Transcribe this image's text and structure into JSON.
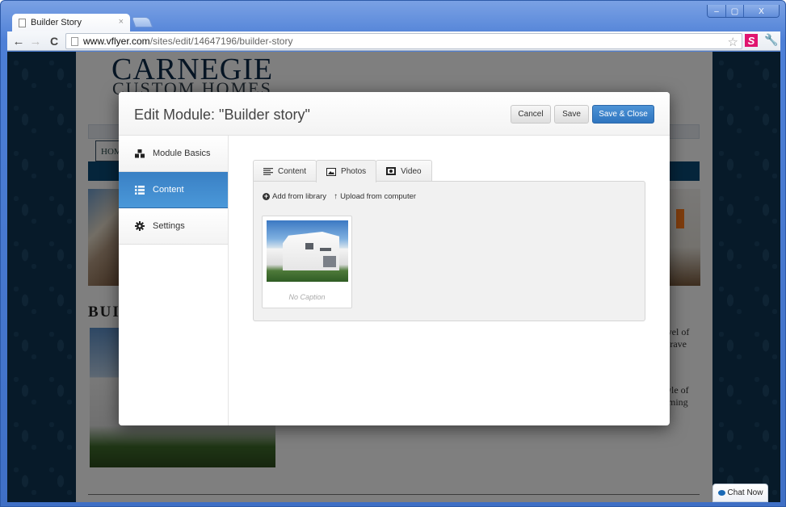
{
  "browser": {
    "tab_title": "Builder Story",
    "tab_close": "×",
    "url_host": "www.vflyer.com",
    "url_path": "/sites/edit/14647196/builder-story",
    "window_controls": [
      "–",
      "▢",
      "X"
    ],
    "nav": {
      "back": "←",
      "forward": "→",
      "reload": "C"
    },
    "bookmark_star": "☆",
    "extension_label": "S",
    "wrench": "🔧"
  },
  "site": {
    "logo_line1": "CARNEGIE",
    "logo_line2": "CUSTOM HOMES",
    "home_tab": "HOME",
    "section_title": "BUILDER STORY",
    "side_text_1": [
      "level of",
      "r crave"
    ],
    "side_text_2": [
      "style of",
      "orming"
    ],
    "chat_label": "Chat Now"
  },
  "modal": {
    "title": "Edit Module: \"Builder story\"",
    "buttons": {
      "cancel": "Cancel",
      "save": "Save",
      "save_close": "Save & Close"
    },
    "sidebar": [
      {
        "label": "Module Basics",
        "icon": "blocks-icon",
        "active": false
      },
      {
        "label": "Content",
        "icon": "list-icon",
        "active": true
      },
      {
        "label": "Settings",
        "icon": "gear-icon",
        "active": false
      }
    ],
    "tabs": [
      {
        "label": "Content",
        "icon": "text-lines-icon",
        "active": false
      },
      {
        "label": "Photos",
        "icon": "picture-icon",
        "active": true
      },
      {
        "label": "Video",
        "icon": "film-icon",
        "active": false
      }
    ],
    "actions": {
      "add_library": "Add from library",
      "upload": "Upload from computer"
    },
    "photos": [
      {
        "caption": "No Caption"
      }
    ]
  },
  "colors": {
    "primary_button": "#3a82c8",
    "active_sidebar": "#4290d2",
    "window_frame": "#4a78c9",
    "site_bg": "#0f3452"
  }
}
